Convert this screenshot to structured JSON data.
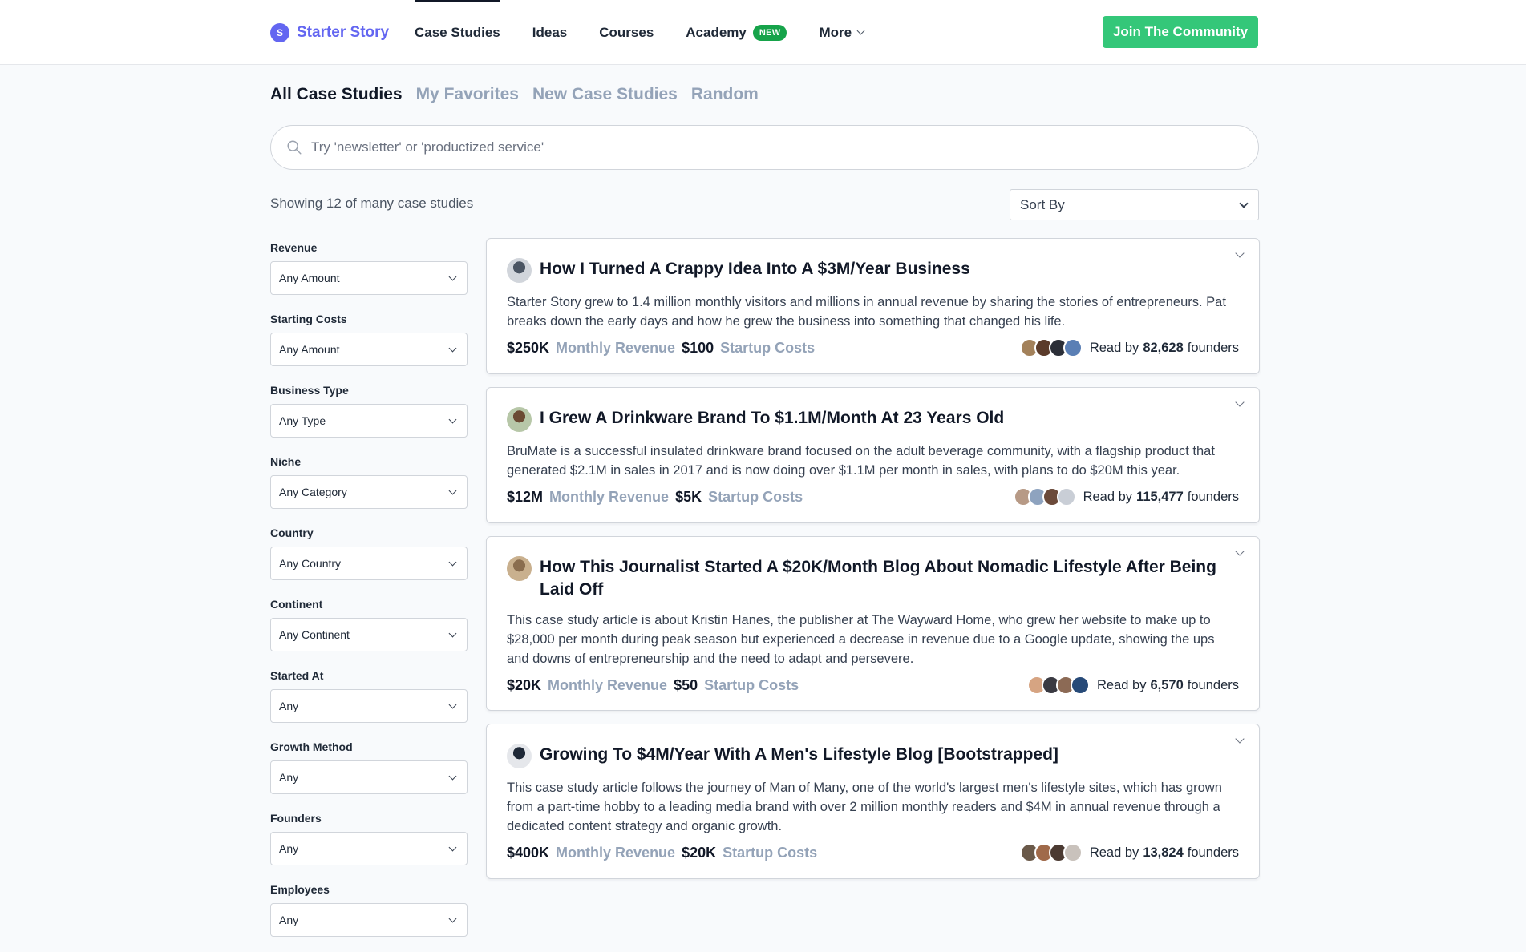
{
  "header": {
    "brand_initial": "S",
    "brand_name": "Starter Story",
    "nav": [
      {
        "label": "Case Studies",
        "active": true
      },
      {
        "label": "Ideas"
      },
      {
        "label": "Courses"
      },
      {
        "label": "Academy",
        "badge": "NEW"
      },
      {
        "label": "More",
        "dropdown": true
      }
    ],
    "cta_label": "Join The Community",
    "accent_color": "#6366f1",
    "cta_color": "#34c779"
  },
  "subtabs": [
    "All Case Studies",
    "My Favorites",
    "New Case Studies",
    "Random"
  ],
  "search": {
    "placeholder": "Try 'newsletter' or 'productized service'",
    "icon": "search-icon"
  },
  "showing_text": "Showing 12 of many case studies",
  "sort": {
    "label": "Sort By"
  },
  "filters": [
    {
      "label": "Revenue",
      "value": "Any Amount"
    },
    {
      "label": "Starting Costs",
      "value": "Any Amount"
    },
    {
      "label": "Business Type",
      "value": "Any Type"
    },
    {
      "label": "Niche",
      "value": "Any Category"
    },
    {
      "label": "Country",
      "value": "Any Country"
    },
    {
      "label": "Continent",
      "value": "Any Continent"
    },
    {
      "label": "Started At",
      "value": "Any"
    },
    {
      "label": "Growth Method",
      "value": "Any"
    },
    {
      "label": "Founders",
      "value": "Any"
    },
    {
      "label": "Employees",
      "value": "Any"
    }
  ],
  "cards": [
    {
      "title": "How I Turned A Crappy Idea Into A $3M/Year Business",
      "description": "Starter Story grew to 1.4 million monthly visitors and millions in annual revenue by sharing the stories of entrepreneurs. Pat breaks down the early days and how he grew the business into something that changed his life.",
      "revenue": "$250K",
      "revenue_label": "Monthly Revenue",
      "costs": "$100",
      "costs_label": "Startup Costs",
      "read_prefix": "Read by",
      "read_count": "82,628",
      "read_suffix": "founders",
      "avatar_colors": [
        "#4b5563",
        "#d1d5db"
      ],
      "reader_colors": [
        "#a3815a",
        "#5b3b2a",
        "#2b2f38",
        "#5a7fb5"
      ]
    },
    {
      "title": "I Grew A Drinkware Brand To $1.1M/Month At 23 Years Old",
      "description": "BruMate is a successful insulated drinkware brand focused on the adult beverage community, with a flagship product that generated $2.1M in sales in 2017 and is now doing over $1.1M per month in sales, with plans to do $20M this year.",
      "revenue": "$12M",
      "revenue_label": "Monthly Revenue",
      "costs": "$5K",
      "costs_label": "Startup Costs",
      "read_prefix": "Read by",
      "read_count": "115,477",
      "read_suffix": "founders",
      "avatar_colors": [
        "#6b4a33",
        "#b7c7a8"
      ],
      "reader_colors": [
        "#b79a86",
        "#8ea3bf",
        "#6b4a3a",
        "#c9ced6"
      ]
    },
    {
      "title": "How This Journalist Started A $20K/Month Blog About Nomadic Lifestyle After Being Laid Off",
      "description": "This case study article is about Kristin Hanes, the publisher at The Wayward Home, who grew her website to make up to $28,000 per month during peak season but experienced a decrease in revenue due to a Google update, showing the ups and downs of entrepreneurship and the need to adapt and persevere.",
      "revenue": "$20K",
      "revenue_label": "Monthly Revenue",
      "costs": "$50",
      "costs_label": "Startup Costs",
      "read_prefix": "Read by",
      "read_count": "6,570",
      "read_suffix": "founders",
      "avatar_colors": [
        "#8a6d4f",
        "#c9b08e"
      ],
      "reader_colors": [
        "#d6a482",
        "#3a3a42",
        "#8c6a55",
        "#274a78"
      ]
    },
    {
      "title": "Growing To $4M/Year With A Men's Lifestyle Blog [Bootstrapped]",
      "description": "This case study article follows the journey of Man of Many, one of the world's largest men's lifestyle sites, which has grown from a part-time hobby to a leading media brand with over 2 million monthly readers and $4M in annual revenue through a dedicated content strategy and organic growth.",
      "revenue": "$400K",
      "revenue_label": "Monthly Revenue",
      "costs": "$20K",
      "costs_label": "Startup Costs",
      "read_prefix": "Read by",
      "read_count": "13,824",
      "read_suffix": "founders",
      "avatar_colors": [
        "#1f2937",
        "#e5e7eb"
      ],
      "reader_colors": [
        "#6b5a4a",
        "#a06a4a",
        "#4b3a32",
        "#c9c2bc"
      ]
    }
  ]
}
